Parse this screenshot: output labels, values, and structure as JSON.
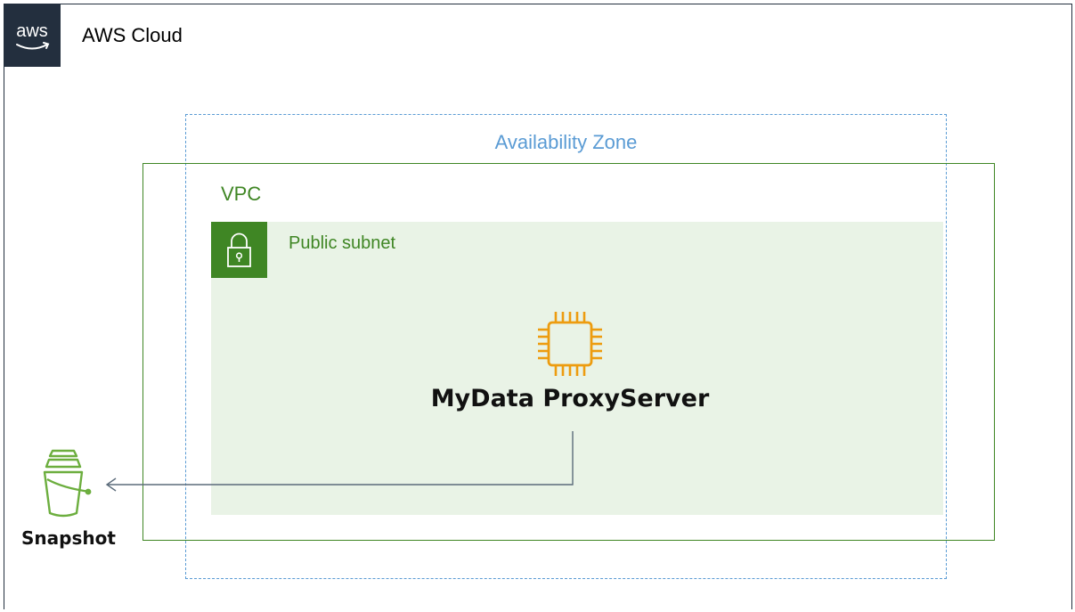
{
  "cloud": {
    "label": "AWS Cloud",
    "logo_text": "aws"
  },
  "availability_zone": {
    "label": "Availability Zone"
  },
  "vpc": {
    "label": "VPC"
  },
  "subnet": {
    "label": "Public subnet",
    "icon": "lock-icon"
  },
  "server": {
    "label": "MyData ProxyServer",
    "icon": "ec2-instance-icon"
  },
  "snapshot": {
    "label": "Snapshot",
    "icon": "s3-bucket-icon"
  },
  "colors": {
    "aws_dark": "#232f3e",
    "az_blue": "#5a9bd4",
    "vpc_green": "#3f8624",
    "subnet_fill": "#e9f3e6",
    "ec2_orange": "#ed9c0f",
    "s3_green": "#6cae3e",
    "arrow": "#5b6b7a"
  }
}
